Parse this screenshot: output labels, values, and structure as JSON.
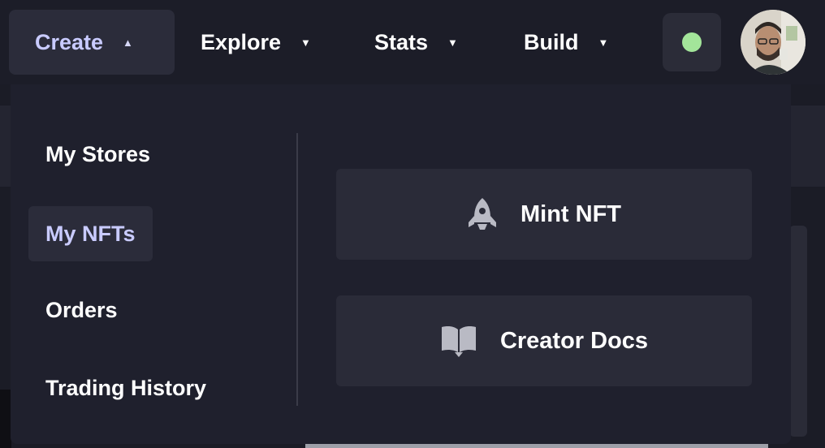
{
  "nav": {
    "create": "Create",
    "explore": "Explore",
    "stats": "Stats",
    "build": "Build",
    "create_caret": "▲",
    "explore_caret": "▼",
    "stats_caret": "▼",
    "build_caret": "▼"
  },
  "status": {
    "color": "#a3e59a"
  },
  "dropdown": {
    "items": [
      {
        "label": "My Stores"
      },
      {
        "label": "My NFTs"
      },
      {
        "label": "Orders"
      },
      {
        "label": "Trading History"
      }
    ],
    "actions": [
      {
        "label": "Mint NFT",
        "icon": "rocket-icon"
      },
      {
        "label": "Creator Docs",
        "icon": "book-icon"
      }
    ]
  },
  "colors": {
    "accent_text": "#c9cbff",
    "panel": "#1f202d",
    "card": "#2a2b38"
  }
}
